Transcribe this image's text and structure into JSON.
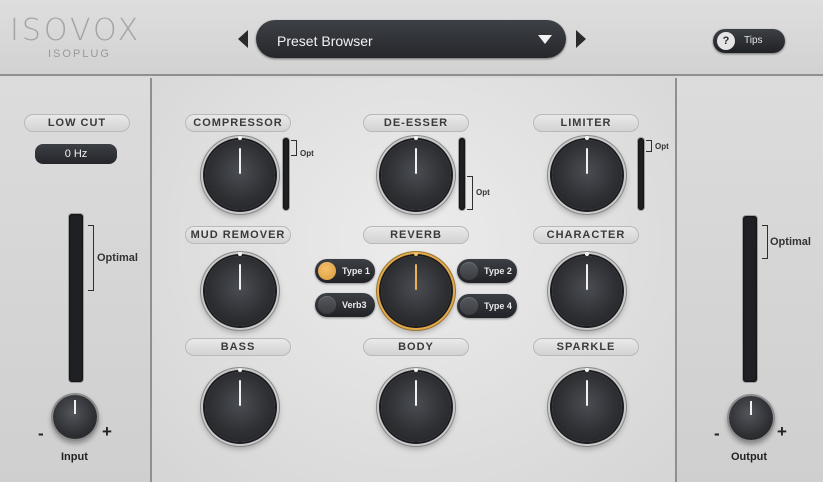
{
  "header": {
    "logo_word": "ISOVOX",
    "logo_sub": "ISOPLUG",
    "preset_label": "Preset Browser",
    "tips_icon": "?",
    "tips_label": "Tips"
  },
  "left": {
    "low_cut_label": "LOW CUT",
    "low_cut_value": "0 Hz",
    "optimal_label": "Optimal",
    "minus": "-",
    "plus": "+",
    "input_label": "Input"
  },
  "right": {
    "optimal_label": "Optimal",
    "minus": "-",
    "plus": "+",
    "output_label": "Output"
  },
  "modules": {
    "compressor": "COMPRESSOR",
    "compressor_opt": "Opt",
    "deesser": "DE-ESSER",
    "deesser_opt": "Opt",
    "limiter": "LIMITER",
    "limiter_opt": "Opt",
    "mud_remover": "MUD REMOVER",
    "reverb": "REVERB",
    "character": "CHARACTER",
    "bass": "BASS",
    "body": "BODY",
    "sparkle": "SPARKLE"
  },
  "reverb_types": {
    "type1": "Type 1",
    "type2": "Type 2",
    "verb3": "Verb3",
    "type4": "Type 4",
    "active": "Type 1"
  },
  "colors": {
    "accent": "#e0a94a",
    "panel": "#d9d9d9",
    "control_dark": "#2e3034"
  }
}
